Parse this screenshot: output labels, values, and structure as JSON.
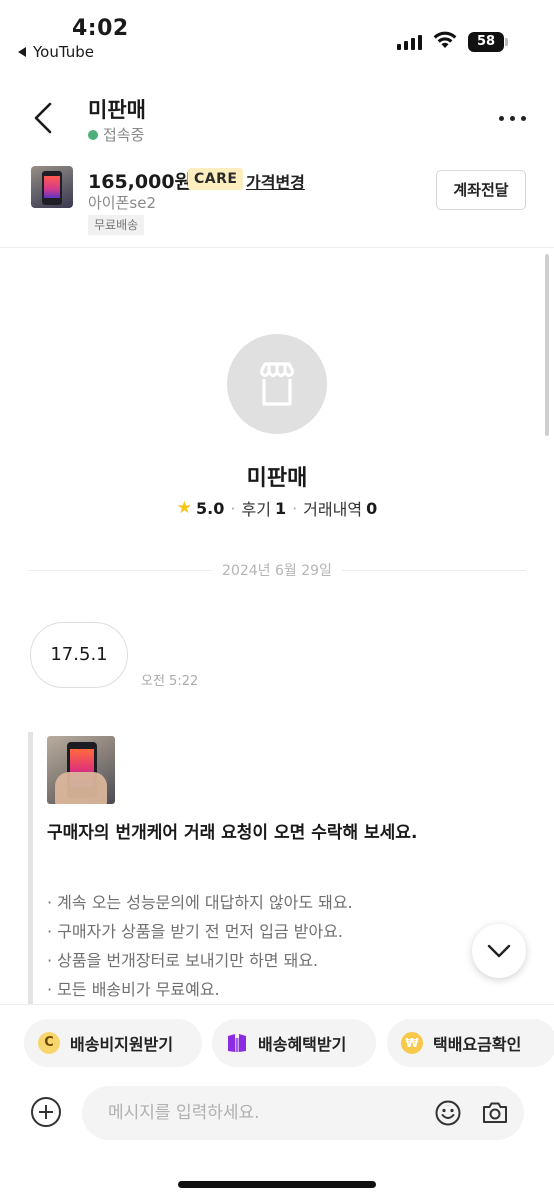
{
  "status_bar": {
    "time": "4:02",
    "back_app": "YouTube",
    "battery": "58"
  },
  "header": {
    "title": "미판매",
    "status": "접속중"
  },
  "product": {
    "price": "165,000원",
    "badge": "CARE",
    "price_change": "가격변경",
    "name": "아이폰se2",
    "shipping_tag": "무료배송",
    "account_button": "계좌전달"
  },
  "seller": {
    "name": "미판매",
    "rating": "5.0",
    "review_label": "후기",
    "review_count": "1",
    "trade_label": "거래내역",
    "trade_count": "0"
  },
  "date_divider": "2024년 6월 29일",
  "message": {
    "text": "17.5.1",
    "time": "오전 5:22"
  },
  "care_card": {
    "title": "구매자의 번개케어 거래 요청이 오면 수락해 보세요.",
    "items": [
      "· 계속 오는 성능문의에 대답하지 않아도 돼요.",
      "· 구매자가 상품을 받기 전 먼저 입금 받아요.",
      "· 상품을 번개장터로 보내기만 하면 돼요.",
      "· 모든 배송비가 무료예요."
    ]
  },
  "quick_actions": [
    {
      "label": "배송비지원받기",
      "icon": "coin-c-icon"
    },
    {
      "label": "배송혜택받기",
      "icon": "box-icon"
    },
    {
      "label": "택배요금확인",
      "icon": "won-coin-icon"
    }
  ],
  "input": {
    "placeholder": "메시지를 입력하세요.",
    "value": ""
  },
  "colors": {
    "online": "#4caf7c",
    "care_badge_bg": "#fdeec0",
    "star": "#f5c518",
    "box_icon": "#8b2be2"
  }
}
